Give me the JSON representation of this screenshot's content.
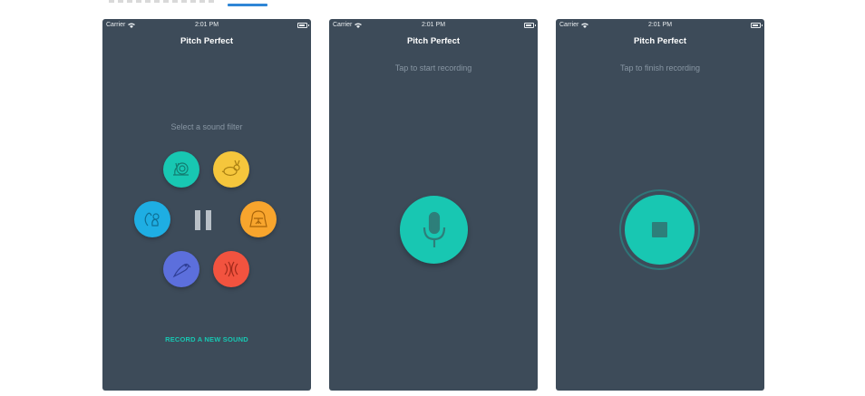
{
  "status_bar": {
    "carrier": "Carrier",
    "time": "2:01 PM"
  },
  "screens": [
    {
      "title": "Pitch Perfect",
      "hint": "Select a sound filter",
      "filters": [
        {
          "name": "slow",
          "icon": "snail-icon",
          "color": "#18c7b2"
        },
        {
          "name": "fast",
          "icon": "rabbit-icon",
          "color": "#f5c63c"
        },
        {
          "name": "chipmunk",
          "icon": "squirrel-icon",
          "color": "#1eaee3"
        },
        {
          "name": "vader",
          "icon": "darth-vader-icon",
          "color": "#f8a52d"
        },
        {
          "name": "echo",
          "icon": "parrot-icon",
          "color": "#5c6fdc"
        },
        {
          "name": "reverb",
          "icon": "reverb-waves-icon",
          "color": "#f2533f"
        }
      ],
      "action": "RECORD A NEW SOUND"
    },
    {
      "title": "Pitch Perfect",
      "hint": "Tap to start recording",
      "accent": "#18c7b2"
    },
    {
      "title": "Pitch Perfect",
      "hint": "Tap to finish recording",
      "accent": "#18c7b2"
    }
  ],
  "colors": {
    "background": "#3d4b59",
    "accent": "#18c7b2",
    "hint": "#8896a3"
  }
}
